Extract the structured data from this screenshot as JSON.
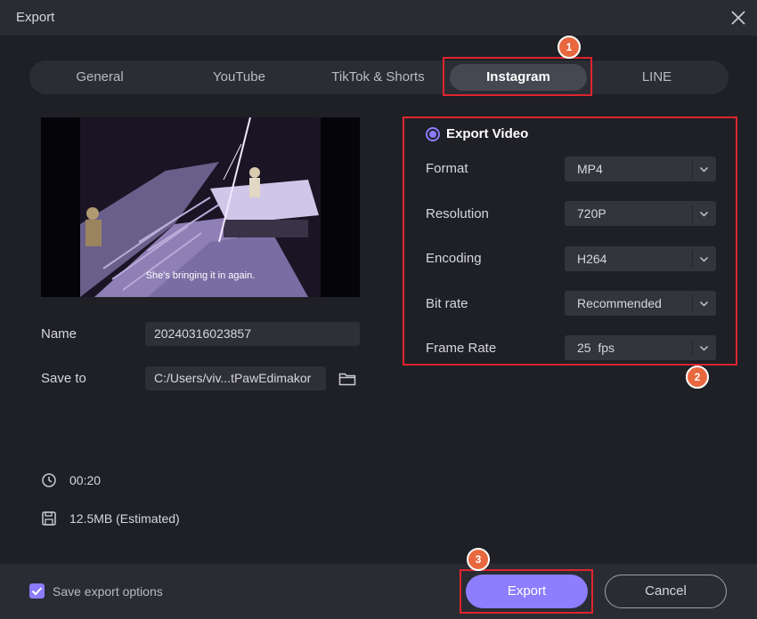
{
  "window": {
    "title": "Export",
    "close_icon": "close-icon"
  },
  "tabs": [
    {
      "label": "General"
    },
    {
      "label": "YouTube"
    },
    {
      "label": "TikTok & Shorts"
    },
    {
      "label": "Instagram",
      "active": true
    },
    {
      "label": "LINE"
    }
  ],
  "preview": {
    "subtitle": "She's bringing it in again."
  },
  "file": {
    "name_label": "Name",
    "name_value": "20240316023857",
    "save_label": "Save to",
    "save_value": "C:/Users/viv...tPawEdimakor",
    "folder_icon": "folder-icon"
  },
  "info": {
    "duration": "00:20",
    "size": "12.5MB (Estimated)",
    "clock_icon": "clock-icon",
    "disk_icon": "disk-icon"
  },
  "settings": {
    "export_video_label": "Export Video",
    "rows": [
      {
        "label": "Format",
        "value": "MP4"
      },
      {
        "label": "Resolution",
        "value": "720P"
      },
      {
        "label": "Encoding",
        "value": "H264"
      },
      {
        "label": "Bit rate",
        "value": "Recommended"
      },
      {
        "label": "Frame Rate",
        "value": "25  fps"
      }
    ]
  },
  "annotations": {
    "badge1": "1",
    "badge2": "2",
    "badge3": "3",
    "color": "#e0242e"
  },
  "footer": {
    "save_options_label": "Save export options",
    "save_options_checked": true,
    "export_label": "Export",
    "cancel_label": "Cancel"
  },
  "colors": {
    "accent": "#8d7dff",
    "background": "#1f2026",
    "titlebar": "#2b2c33"
  }
}
